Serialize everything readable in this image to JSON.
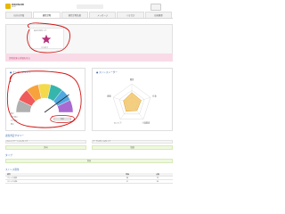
{
  "header": {
    "logo_text": "RIKUNABI",
    "logo_sub": "NEXT",
    "icon": "user-icon"
  },
  "tabs": [
    {
      "label": "自分の評価",
      "active": false
    },
    {
      "label": "適性診断",
      "active": true
    },
    {
      "label": "適性診断結果",
      "active": false
    },
    {
      "label": "メッセージ",
      "active": false
    },
    {
      "label": "ぐるなび",
      "active": false
    },
    {
      "label": "応募履歴",
      "active": false
    }
  ],
  "star_card": {
    "label": "あなたのタイプ",
    "caption": "ひらめき",
    "icon": "star-icon",
    "star_color": "#b5307a"
  },
  "banner": {
    "text": "診断結果の詳細を見る"
  },
  "left_panel": {
    "title": "● エンゲージメント",
    "gauge": {
      "segments": [
        {
          "color": "#b0b0b0",
          "value": 1
        },
        {
          "color": "#f15a5a",
          "value": 1
        },
        {
          "color": "#f7a23c",
          "value": 1
        },
        {
          "color": "#f4d94b",
          "value": 1
        },
        {
          "color": "#36b5ad",
          "value": 1
        },
        {
          "color": "#52a8e0",
          "value": 1
        },
        {
          "color": "#a86ad1",
          "value": 1
        }
      ],
      "needle_level": 0.2,
      "labels": [
        "高い",
        "やや高い",
        "やや低い",
        "低い"
      ],
      "value_text": "判定"
    }
  },
  "right_panel": {
    "title": "● ストレスレーダー",
    "radar": {
      "axes": [
        "職場",
        "仕事",
        "人間関係",
        "キャリア",
        "健康"
      ],
      "levels": 3,
      "values": [
        0.55,
        0.5,
        0.45,
        0.5,
        0.45
      ],
      "fill": "#f3c76b",
      "stroke": "#d9a23b"
    }
  },
  "section1": {
    "title": "適性判定サマリー",
    "left_head": "コミュニケーションタイプ",
    "left_body": "外向",
    "right_head": "ワークスタイルタイプ",
    "right_body": "協調"
  },
  "section2": {
    "title": "タイプ",
    "bar": "外向"
  },
  "section3": {
    "title": "ストレス耐性",
    "table": {
      "headers": [
        "項目",
        "評価",
        "点数"
      ],
      "rows": [
        [
          "ストレス耐性",
          "高",
          "72"
        ],
        [
          "ストレス対処",
          "中",
          "55"
        ]
      ]
    }
  },
  "colors": {
    "accent_blue": "#3f6fb3",
    "annotation_red": "#d21414",
    "banner_pink": "#f9dbe7"
  }
}
